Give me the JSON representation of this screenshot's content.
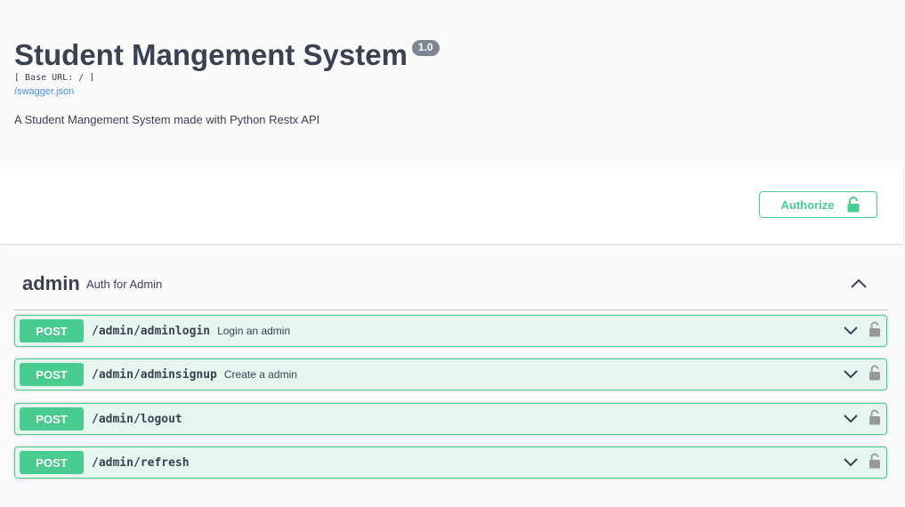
{
  "info": {
    "title": "Student Mangement System",
    "version": "1.0",
    "base_url": "[ Base URL: / ]",
    "spec_link": "/swagger.json",
    "description": "A Student Mangement System made with Python Restx API"
  },
  "scheme": {
    "authorize_label": "Authorize"
  },
  "tag": {
    "name": "admin",
    "description": "Auth for Admin"
  },
  "operations": [
    {
      "method": "POST",
      "path": "/admin/adminlogin",
      "summary": "Login an admin"
    },
    {
      "method": "POST",
      "path": "/admin/adminsignup",
      "summary": "Create a admin"
    },
    {
      "method": "POST",
      "path": "/admin/logout",
      "summary": ""
    },
    {
      "method": "POST",
      "path": "/admin/refresh",
      "summary": ""
    }
  ],
  "colors": {
    "post_green": "#49cc90",
    "text": "#3b4151",
    "link": "#4990e2",
    "version_badge": "#7d8492",
    "lock_gray": "#999999"
  },
  "icons": {
    "authorize": "unlocked-padlock-icon",
    "tag_toggle": "chevron-up-icon",
    "op_expand": "chevron-down-icon",
    "op_lock": "unlocked-padlock-icon"
  }
}
